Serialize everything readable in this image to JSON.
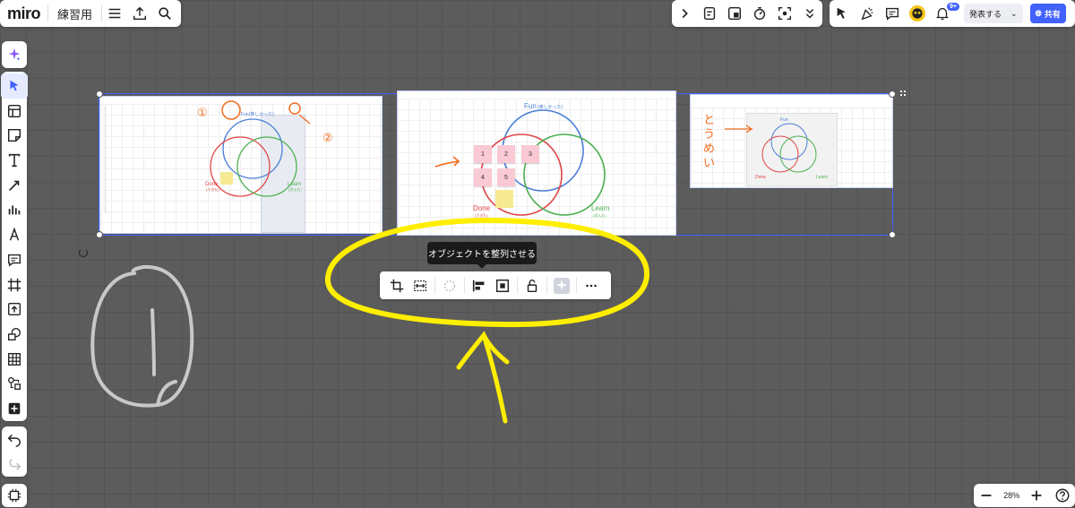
{
  "app": {
    "logo": "miro",
    "board_name": "練習用"
  },
  "header_right": {
    "present_label": "発表する",
    "share_label": "共有",
    "notifications_badge": "9+"
  },
  "tooltip": {
    "text": "オブジェクトを整列させる"
  },
  "zoom": {
    "level": "28%"
  },
  "frames": {
    "frame1": {
      "fun": "Fun(楽しかった)",
      "done": "Done",
      "done_sub": "(できた)",
      "learn": "Learn",
      "learn_sub": "(学んだ)",
      "mark1": "①",
      "mark2": "②"
    },
    "frame2": {
      "fun": "Fun",
      "fun_sub": "(楽しかった)",
      "done": "Done",
      "done_sub": "(できた)",
      "learn": "Learn",
      "learn_sub": "(学んだ)",
      "notes": [
        "1",
        "2",
        "3",
        "4",
        "5"
      ]
    },
    "frame3": {
      "fun": "Fun",
      "done": "Done",
      "learn": "Learn",
      "handwriting": "とうめい"
    }
  },
  "colors": {
    "accent": "#4262ff",
    "canvas": "#5c5c5c",
    "annotation_yellow": "#ffee00",
    "annotation_orange": "#f26b1d"
  },
  "icons": {
    "header_left": [
      "menu-icon",
      "upload-icon",
      "search-icon"
    ],
    "header_tools": [
      "chevron-right-icon",
      "apps-icon",
      "frame-icon",
      "timer-icon",
      "focus-icon",
      "chevron-down-icon"
    ],
    "header_right": [
      "cursor-icon",
      "celebrate-icon",
      "comment-icon",
      "bell-icon",
      "globe-icon"
    ],
    "context_bar": [
      "crop-icon",
      "fit-icon",
      "spinner-icon",
      "align-icon",
      "arrange-icon",
      "lock-icon",
      "ai-icon",
      "more-icon"
    ]
  }
}
